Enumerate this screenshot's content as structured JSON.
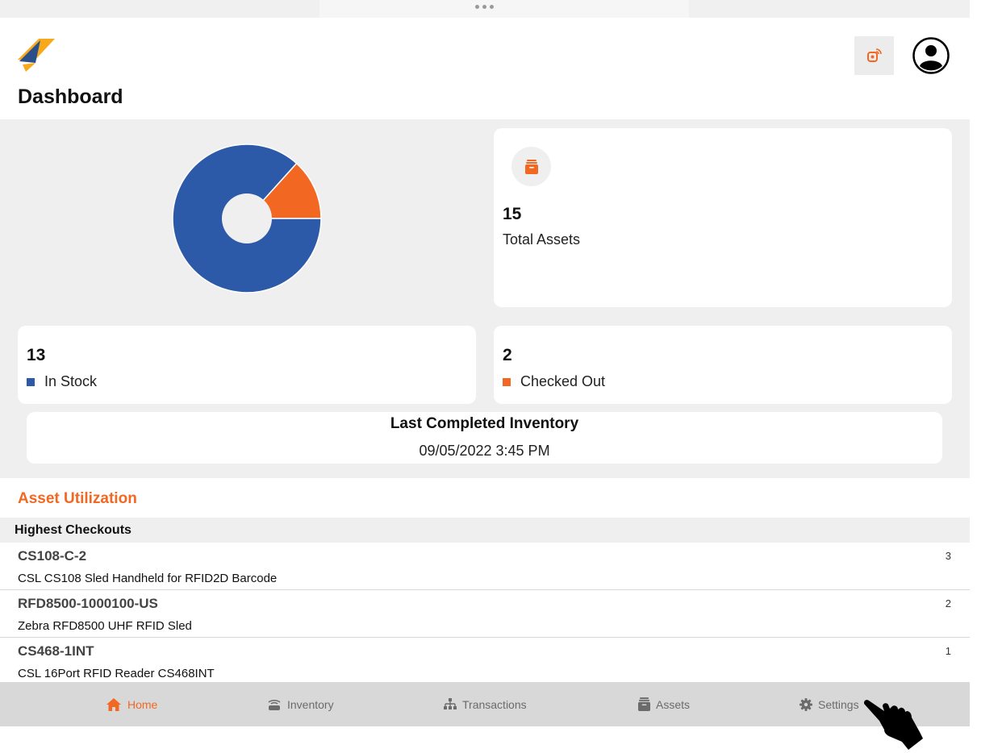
{
  "header": {
    "logo_icon": "stackbar-logo-icon",
    "rfid_icon": "rfid-scanner-icon",
    "avatar_icon": "user-avatar-icon",
    "title": "Dashboard"
  },
  "colors": {
    "accent": "#f26722",
    "in_stock": "#2d5aa8",
    "checked_out": "#f26722",
    "panel_bg": "#efefef",
    "tabbar_bg": "#d8d8d8"
  },
  "chart_data": {
    "type": "pie",
    "categories": [
      "In Stock",
      "Checked Out"
    ],
    "values": [
      13,
      2
    ]
  },
  "summary": {
    "total": {
      "value": "15",
      "label": "Total Assets",
      "icon": "archive-box-icon"
    },
    "in_stock": {
      "value": "13",
      "label": "In Stock"
    },
    "checked_out": {
      "value": "2",
      "label": "Checked Out"
    },
    "last_inventory": {
      "title": "Last Completed Inventory",
      "date": "09/05/2022 3:45 PM"
    }
  },
  "utilization": {
    "title": "Asset Utilization",
    "list_title": "Highest Checkouts",
    "items": [
      {
        "code": "CS108-C-2",
        "description": "CSL CS108 Sled Handheld for RFID2D Barcode",
        "count": "3"
      },
      {
        "code": "RFD8500-1000100-US",
        "description": "Zebra RFD8500 UHF RFID Sled",
        "count": "2"
      },
      {
        "code": "CS468-1INT",
        "description": "CSL 16Port RFID Reader CS468INT",
        "count": "1"
      }
    ]
  },
  "tabs": [
    {
      "label": "Home",
      "icon": "home-icon",
      "active": true
    },
    {
      "label": "Inventory",
      "icon": "rfid-reader-icon",
      "active": false
    },
    {
      "label": "Transactions",
      "icon": "hierarchy-icon",
      "active": false
    },
    {
      "label": "Assets",
      "icon": "archive-icon",
      "active": false
    },
    {
      "label": "Settings",
      "icon": "gear-icon",
      "active": false
    }
  ]
}
